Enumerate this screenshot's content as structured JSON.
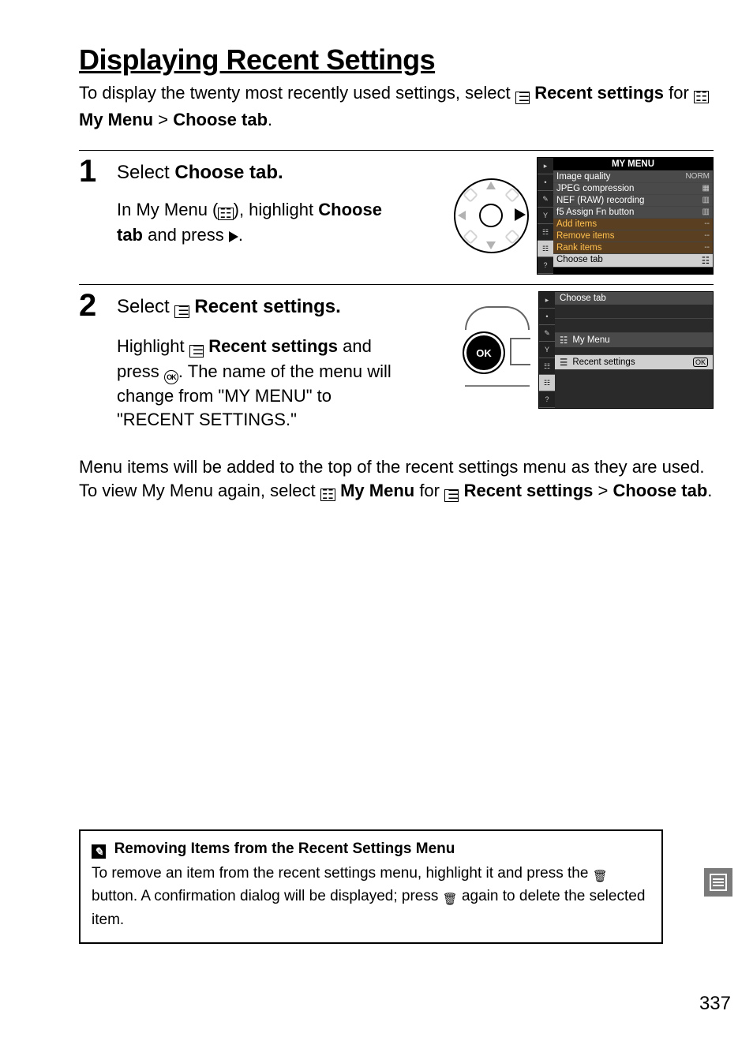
{
  "title": "Displaying Recent Settings",
  "intro_1": "To display the twenty most recently used settings, select ",
  "intro_recent": "Recent settings",
  "intro_for": " for ",
  "intro_mymenu": "My Menu",
  "intro_gt": " > ",
  "intro_choose": "Choose tab",
  "step1_num": "1",
  "step1_head_a": "Select ",
  "step1_head_b": "Choose tab.",
  "step1_text_a": "In My Menu (",
  "step1_text_b": "), highlight ",
  "step1_text_c": "Choose tab",
  "step1_text_d": " and press ",
  "step2_num": "2",
  "step2_head_a": "Select ",
  "step2_head_b": "Recent settings.",
  "step2_text_a": "Highlight ",
  "step2_text_b": "Recent settings",
  "step2_text_c": " and press ",
  "step2_text_d": ". The name of the menu will change from \"MY MENU\" to \"RECENT SETTINGS.\"",
  "para2_a": "Menu items will be added to the top of the recent settings menu as they are used. To view My Menu again, select ",
  "para2_b": "My Menu",
  "para2_c": " for ",
  "para2_d": "Recent settings",
  "para2_e": " > ",
  "para2_f": "Choose tab",
  "lcd1": {
    "title": "MY MENU",
    "rows": [
      {
        "label": "Image quality",
        "val": "NORM"
      },
      {
        "label": "JPEG compression",
        "val": "▦"
      },
      {
        "label": "NEF (RAW) recording",
        "val": "▥"
      },
      {
        "label": "f5 Assign Fn button",
        "val": "▥"
      },
      {
        "label": "Add items",
        "val": "--"
      },
      {
        "label": "Remove items",
        "val": "--"
      },
      {
        "label": "Rank items",
        "val": "--"
      },
      {
        "label": "Choose tab",
        "val": "☷"
      }
    ]
  },
  "lcd2": {
    "header": "Choose tab",
    "item_my": "My Menu",
    "item_recent": "Recent settings",
    "ok_badge": "OK"
  },
  "ok_label": "OK",
  "tip_title": "Removing Items from the Recent Settings Menu",
  "tip_a": "To remove an item from the recent settings menu, highlight it and press the ",
  "tip_b": " button. A confirmation dialog will be displayed; press ",
  "tip_c": " again to delete the selected item.",
  "page_number": "337"
}
